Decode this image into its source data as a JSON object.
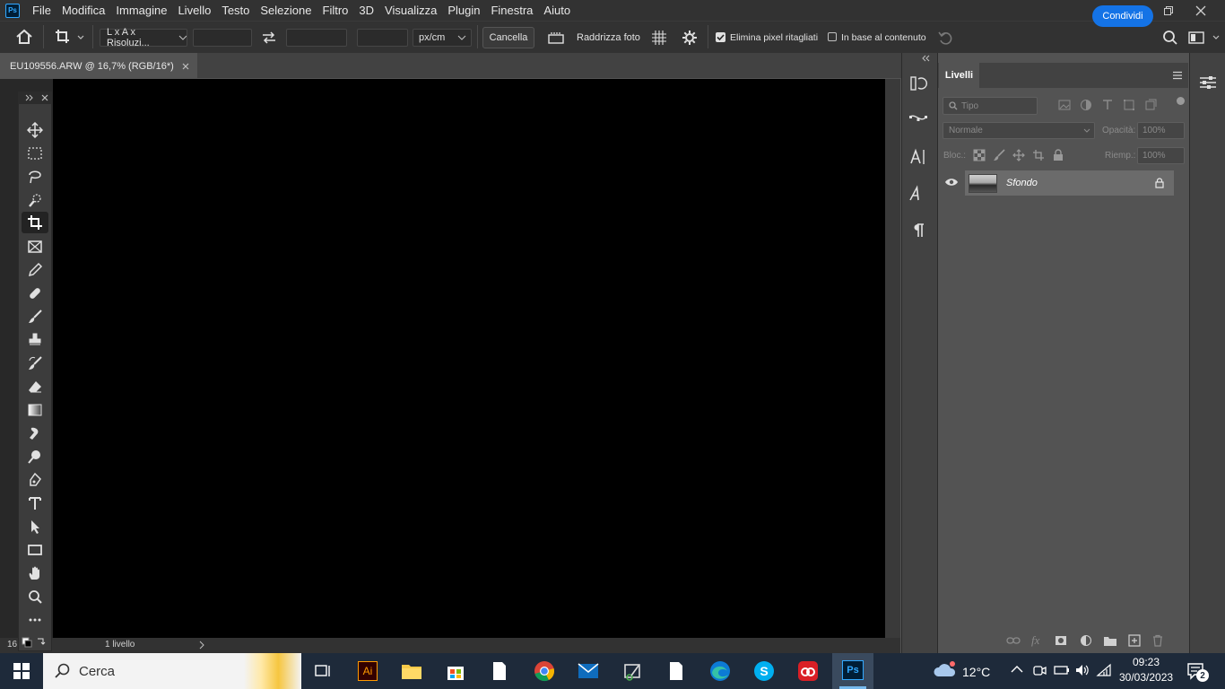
{
  "app": {
    "logo_text": "Ps",
    "menu": [
      "File",
      "Modifica",
      "Immagine",
      "Livello",
      "Testo",
      "Selezione",
      "Filtro",
      "3D",
      "Visualizza",
      "Plugin",
      "Finestra",
      "Aiuto"
    ]
  },
  "options": {
    "ratio_select": "L x A x Risoluzi...",
    "width_value": "",
    "height_value": "",
    "resolution_value": "",
    "unit_select": "px/cm",
    "cancel_label": "Cancella",
    "straighten_label": "Raddrizza foto",
    "delete_cropped_label": "Elimina pixel ritagliati",
    "delete_cropped_checked": true,
    "content_aware_label": "In base al contenuto",
    "content_aware_checked": false,
    "share_label": "Condividi"
  },
  "document": {
    "tab_title": "EU109556.ARW @ 16,7% (RGB/16*)",
    "status_zoom": "16",
    "status_info": "1 livello"
  },
  "layers_panel": {
    "tab_label": "Livelli",
    "filter_placeholder": "Tipo",
    "blend_mode": "Normale",
    "opacity_label": "Opacità:",
    "opacity_value": "100%",
    "lock_label": "Bloc.:",
    "fill_label": "Riemp.:",
    "fill_value": "100%",
    "layers": [
      {
        "name": "Sfondo",
        "visible": true,
        "locked": true
      }
    ]
  },
  "taskbar": {
    "search_placeholder": "Cerca",
    "weather": "12°C",
    "time": "09:23",
    "date": "30/03/2023",
    "notification_count": "2"
  },
  "colors": {
    "accent": "#1473e6",
    "ps_brand": "#31a8ff",
    "panel_bg": "#535353",
    "canvas": "#000000"
  }
}
